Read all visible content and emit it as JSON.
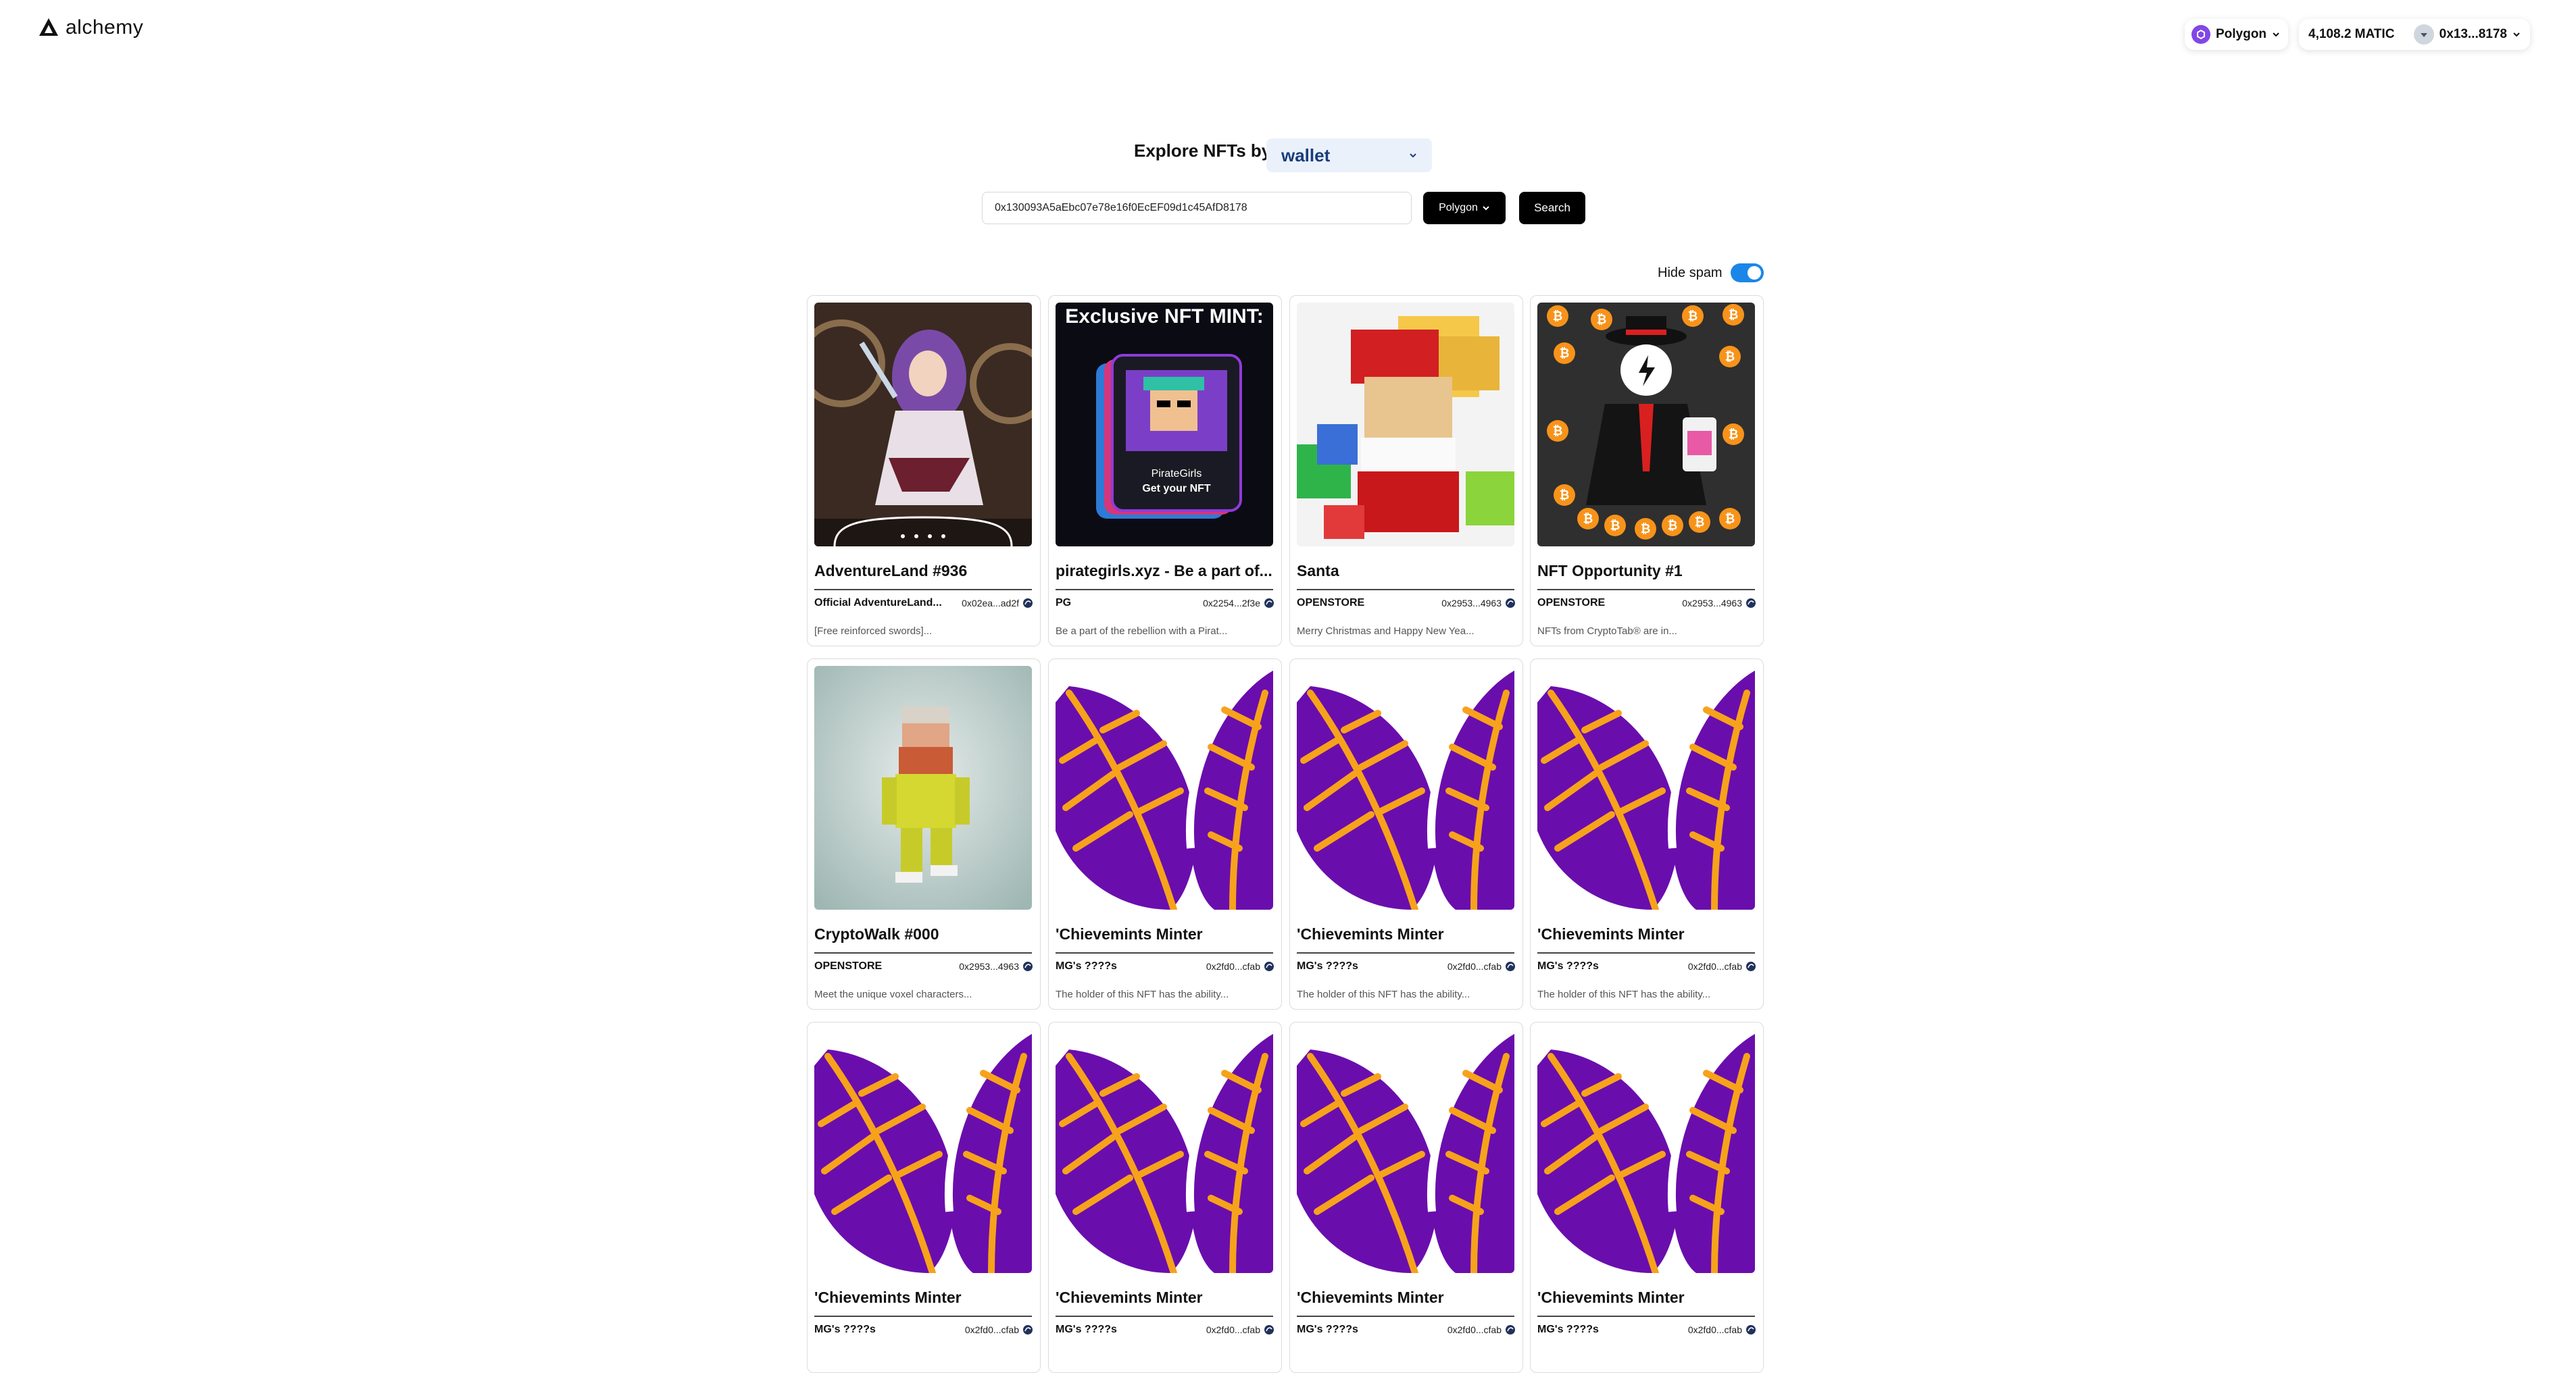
{
  "header": {
    "logo_text": "alchemy",
    "network_label": "Polygon",
    "balance": "4,108.2 MATIC",
    "address_short": "0x13...8178"
  },
  "explore": {
    "label": "Explore NFTs by",
    "search_type": "wallet",
    "address_value": "0x130093A5aEbc07e78e16f0EcEF09d1c45AfD8178",
    "chain_button": "Polygon",
    "search_button": "Search",
    "spam_label": "Hide spam",
    "spam_enabled": true
  },
  "colors": {
    "accent": "#1c86e8",
    "polygon": "#8247e5",
    "leaf_purple": "#6a0dad",
    "leaf_orange": "#f7a21b"
  },
  "nfts": [
    {
      "title": "AdventureLand #936",
      "collection": "Official AdventureLand...",
      "contract": "0x02ea...ad2f",
      "description": "[Free reinforced swords]...",
      "image": "anime-character-art"
    },
    {
      "title": "pirategirls.xyz - Be a part of...",
      "collection": "PG",
      "contract": "0x2254...2f3e",
      "description": "Be a part of the rebellion with a Pirat...",
      "image": "pirate-girls-mint-card",
      "image_text": "Exclusive NFT MINT:",
      "card_caption_1": "PirateGirls",
      "card_caption_2": "Get your NFT"
    },
    {
      "title": "Santa",
      "collection": "OPENSTORE",
      "contract": "0x2953...4963",
      "description": "Merry Christmas and Happy New Yea...",
      "image": "voxel-santa"
    },
    {
      "title": "NFT Opportunity #1",
      "collection": "OPENSTORE",
      "contract": "0x2953...4963",
      "description": "NFTs from CryptoTab® are in...",
      "image": "bitcoin-businessman"
    },
    {
      "title": "CryptoWalk #000",
      "collection": "OPENSTORE",
      "contract": "0x2953...4963",
      "description": "Meet the unique voxel characters...",
      "image": "voxel-walker"
    },
    {
      "title": "'Chievemints Minter",
      "collection": "MG's ????s",
      "contract": "0x2fd0...cfab",
      "description": "The holder of this NFT has the ability...",
      "image": "purple-leaf"
    },
    {
      "title": "'Chievemints Minter",
      "collection": "MG's ????s",
      "contract": "0x2fd0...cfab",
      "description": "The holder of this NFT has the ability...",
      "image": "purple-leaf"
    },
    {
      "title": "'Chievemints Minter",
      "collection": "MG's ????s",
      "contract": "0x2fd0...cfab",
      "description": "The holder of this NFT has the ability...",
      "image": "purple-leaf"
    },
    {
      "title": "'Chievemints Minter",
      "collection": "MG's ????s",
      "contract": "0x2fd0...cfab",
      "description": "",
      "image": "purple-leaf"
    },
    {
      "title": "'Chievemints Minter",
      "collection": "MG's ????s",
      "contract": "0x2fd0...cfab",
      "description": "",
      "image": "purple-leaf"
    },
    {
      "title": "'Chievemints Minter",
      "collection": "MG's ????s",
      "contract": "0x2fd0...cfab",
      "description": "",
      "image": "purple-leaf"
    },
    {
      "title": "'Chievemints Minter",
      "collection": "MG's ????s",
      "contract": "0x2fd0...cfab",
      "description": "",
      "image": "purple-leaf"
    }
  ]
}
